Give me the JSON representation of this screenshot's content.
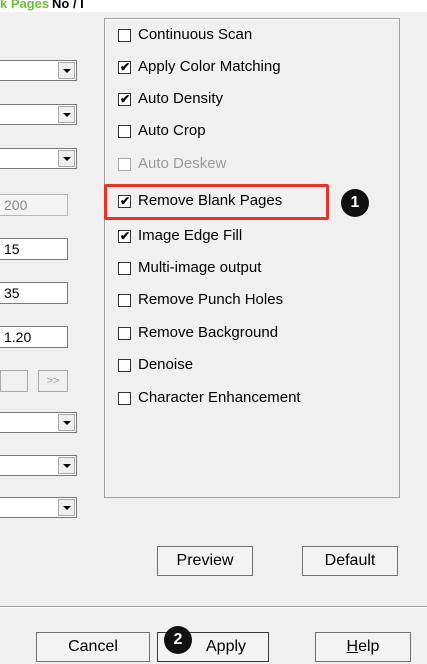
{
  "header": {
    "green_text": "k Pages",
    "black_text": "No / I"
  },
  "left": {
    "combos": [
      "",
      "",
      "",
      ""
    ],
    "fields": [
      {
        "value": "200",
        "disabled": true
      },
      {
        "value": "15",
        "disabled": false
      },
      {
        "value": "35",
        "disabled": false
      },
      {
        "value": "1.20",
        "disabled": false
      }
    ],
    "nav_next": ">>",
    "combos_lower": [
      "",
      "",
      ""
    ]
  },
  "options": [
    {
      "label": "Continuous Scan",
      "checked": false,
      "disabled": false
    },
    {
      "label": "Apply Color Matching",
      "checked": true,
      "disabled": false
    },
    {
      "label": "Auto Density",
      "checked": true,
      "disabled": false
    },
    {
      "label": "Auto Crop",
      "checked": false,
      "disabled": false
    },
    {
      "label": "Auto Deskew",
      "checked": false,
      "disabled": true
    },
    {
      "label": "Remove Blank Pages",
      "checked": true,
      "disabled": false
    },
    {
      "label": "Image Edge Fill",
      "checked": true,
      "disabled": false
    },
    {
      "label": "Multi-image output",
      "checked": false,
      "disabled": false
    },
    {
      "label": "Remove Punch Holes",
      "checked": false,
      "disabled": false
    },
    {
      "label": "Remove Background",
      "checked": false,
      "disabled": false
    },
    {
      "label": "Denoise",
      "checked": false,
      "disabled": false
    },
    {
      "label": "Character Enhancement",
      "checked": false,
      "disabled": false
    }
  ],
  "callouts": {
    "one": "1",
    "two": "2",
    "highlight_color": "#e8332b"
  },
  "buttons": {
    "preview": "Preview",
    "default": "Default",
    "cancel": "Cancel",
    "apply": "Apply",
    "help_prefix": "H",
    "help_rest": "elp"
  },
  "checkmark_glyph": "✔"
}
